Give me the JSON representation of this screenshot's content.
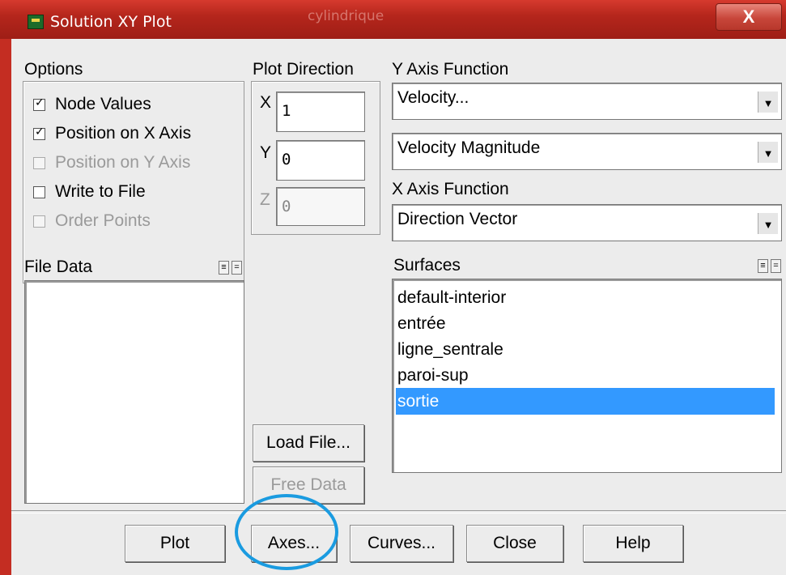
{
  "window": {
    "title": "Solution XY Plot",
    "ghost_tab": "cylindrique",
    "close_label": "X"
  },
  "options": {
    "heading": "Options",
    "items": [
      {
        "label": "Node Values",
        "checked": true,
        "enabled": true
      },
      {
        "label": "Position on X Axis",
        "checked": true,
        "enabled": true
      },
      {
        "label": "Position on Y Axis",
        "checked": false,
        "enabled": false
      },
      {
        "label": "Write to File",
        "checked": false,
        "enabled": true
      },
      {
        "label": "Order Points",
        "checked": false,
        "enabled": false
      }
    ]
  },
  "plot_direction": {
    "heading": "Plot Direction",
    "x_label": "X",
    "x_value": "1",
    "y_label": "Y",
    "y_value": "0",
    "z_label": "Z",
    "z_value": "0"
  },
  "y_axis_function": {
    "heading": "Y Axis Function",
    "category": "Velocity...",
    "quantity": "Velocity Magnitude"
  },
  "x_axis_function": {
    "heading": "X Axis Function",
    "value": "Direction Vector"
  },
  "file_data": {
    "heading": "File Data"
  },
  "surfaces": {
    "heading": "Surfaces",
    "items": [
      "default-interior",
      "entrée",
      "ligne_sentrale",
      "paroi-sup",
      "sortie"
    ],
    "selected": "sortie"
  },
  "buttons": {
    "load_file": "Load File...",
    "free_data": "Free Data",
    "plot": "Plot",
    "axes": "Axes...",
    "curves": "Curves...",
    "close": "Close",
    "help": "Help"
  },
  "colors": {
    "titlebar": "#b5261c",
    "selection": "#3399ff",
    "highlight_ring": "#1a9be0"
  }
}
